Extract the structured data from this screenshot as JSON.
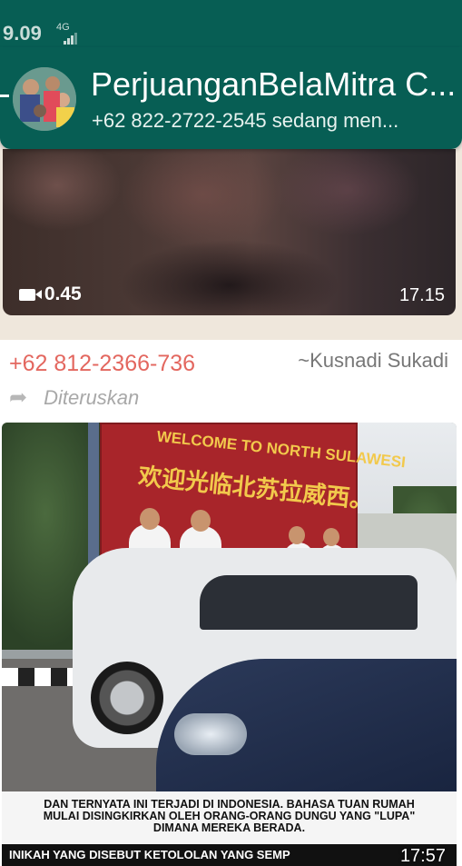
{
  "status_bar": {
    "time": "9.09",
    "network": "4G"
  },
  "header": {
    "title": "PerjuanganBelaMitra C...",
    "subtitle": "+62 822-2722-2545 sedang men..."
  },
  "video_message": {
    "duration": "0.45",
    "time": "17.15"
  },
  "message": {
    "sender_phone": "+62 812-2366-736",
    "sender_name": "~Kusnadi Sukadi",
    "forwarded_label": "Diteruskan",
    "image": {
      "billboard_title": "WELCOME TO NORTH SULAWESI",
      "billboard_chinese": "欢迎光临北苏拉威西。",
      "caption_lines": [
        "DAN TERNYATA INI TERJADI DI INDONESIA. BAHASA TUAN RUMAH",
        "MULAI DISINGKIRKAN OLEH ORANG-ORANG DUNGU YANG \"LUPA\"",
        "DIMANA MEREKA BERADA."
      ],
      "caption_banner": "INIKAH YANG DISEBUT KETOLOLAN YANG SEMP"
    },
    "time": "17:57"
  },
  "colors": {
    "header_bg": "#075e54",
    "sender_phone": "#e3675f",
    "chat_bg": "#efe7dc"
  }
}
